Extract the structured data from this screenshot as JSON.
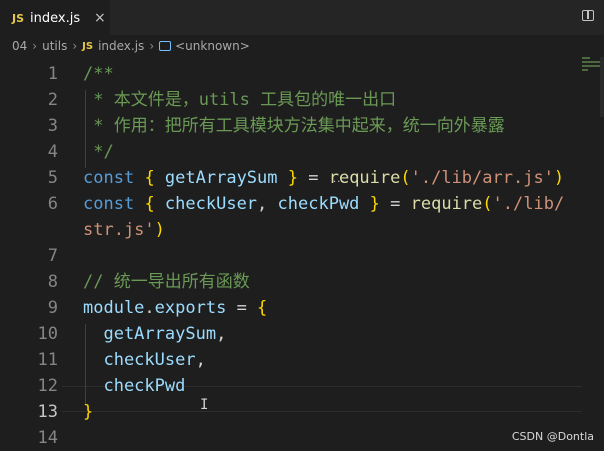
{
  "tabs": [
    {
      "badge": "JS",
      "label": "index.js",
      "close": "×"
    }
  ],
  "breadcrumb": {
    "items": [
      "04",
      "utils",
      "index.js",
      "<unknown>"
    ],
    "file_badge": "JS",
    "separator": "›"
  },
  "editor": {
    "current_line": 13,
    "lines": [
      {
        "n": "1",
        "tokens": [
          {
            "t": "/**",
            "c": "comment"
          }
        ]
      },
      {
        "n": "2",
        "tokens": [
          {
            "t": " * 本文件是，utils 工具包的唯一出口",
            "c": "comment"
          }
        ]
      },
      {
        "n": "3",
        "tokens": [
          {
            "t": " * 作用：把所有工具模块方法集中起来，统一向外暴露",
            "c": "comment"
          }
        ]
      },
      {
        "n": "4",
        "tokens": [
          {
            "t": " */",
            "c": "comment"
          }
        ]
      },
      {
        "n": "5",
        "tokens": [
          {
            "t": "const",
            "c": "kw"
          },
          {
            "t": " ",
            "c": "pl"
          },
          {
            "t": "{",
            "c": "brace"
          },
          {
            "t": " getArraySum ",
            "c": "var"
          },
          {
            "t": "}",
            "c": "brace"
          },
          {
            "t": " = ",
            "c": "pl"
          },
          {
            "t": "require",
            "c": "fn"
          },
          {
            "t": "(",
            "c": "brace"
          },
          {
            "t": "'./lib/arr.js'",
            "c": "str"
          },
          {
            "t": ")",
            "c": "brace"
          }
        ]
      },
      {
        "n": "6",
        "tokens": [
          {
            "t": "const",
            "c": "kw"
          },
          {
            "t": " ",
            "c": "pl"
          },
          {
            "t": "{",
            "c": "brace"
          },
          {
            "t": " checkUser",
            "c": "var"
          },
          {
            "t": ", ",
            "c": "pl"
          },
          {
            "t": "checkPwd ",
            "c": "var"
          },
          {
            "t": "}",
            "c": "brace"
          },
          {
            "t": " = ",
            "c": "pl"
          },
          {
            "t": "require",
            "c": "fn"
          },
          {
            "t": "(",
            "c": "brace"
          },
          {
            "t": "'./lib/",
            "c": "str"
          }
        ]
      },
      {
        "n": "",
        "tokens": [
          {
            "t": "str.js'",
            "c": "str"
          },
          {
            "t": ")",
            "c": "brace"
          }
        ]
      },
      {
        "n": "7",
        "tokens": []
      },
      {
        "n": "8",
        "tokens": [
          {
            "t": "// 统一导出所有函数",
            "c": "comment"
          }
        ]
      },
      {
        "n": "9",
        "tokens": [
          {
            "t": "module",
            "c": "var"
          },
          {
            "t": ".",
            "c": "pl"
          },
          {
            "t": "exports",
            "c": "var"
          },
          {
            "t": " = ",
            "c": "pl"
          },
          {
            "t": "{",
            "c": "brace"
          }
        ]
      },
      {
        "n": "10",
        "tokens": [
          {
            "t": "  getArraySum",
            "c": "var"
          },
          {
            "t": ",",
            "c": "pl"
          }
        ]
      },
      {
        "n": "11",
        "tokens": [
          {
            "t": "  checkUser",
            "c": "var"
          },
          {
            "t": ",",
            "c": "pl"
          }
        ]
      },
      {
        "n": "12",
        "tokens": [
          {
            "t": "  checkPwd",
            "c": "var"
          }
        ]
      },
      {
        "n": "13",
        "tokens": [
          {
            "t": "}",
            "c": "brace"
          }
        ]
      },
      {
        "n": "14",
        "tokens": []
      }
    ]
  },
  "watermark": "CSDN @Dontla",
  "colors": {
    "background": "#1e1e1e",
    "comment": "#6a9955",
    "keyword": "#569cd6",
    "variable": "#9cdcfe",
    "function": "#dcdcaa",
    "string": "#ce9178",
    "brace": "#ffd700"
  },
  "icons": [
    "js-file-icon",
    "close-icon",
    "split-editor-icon",
    "symbol-icon"
  ]
}
